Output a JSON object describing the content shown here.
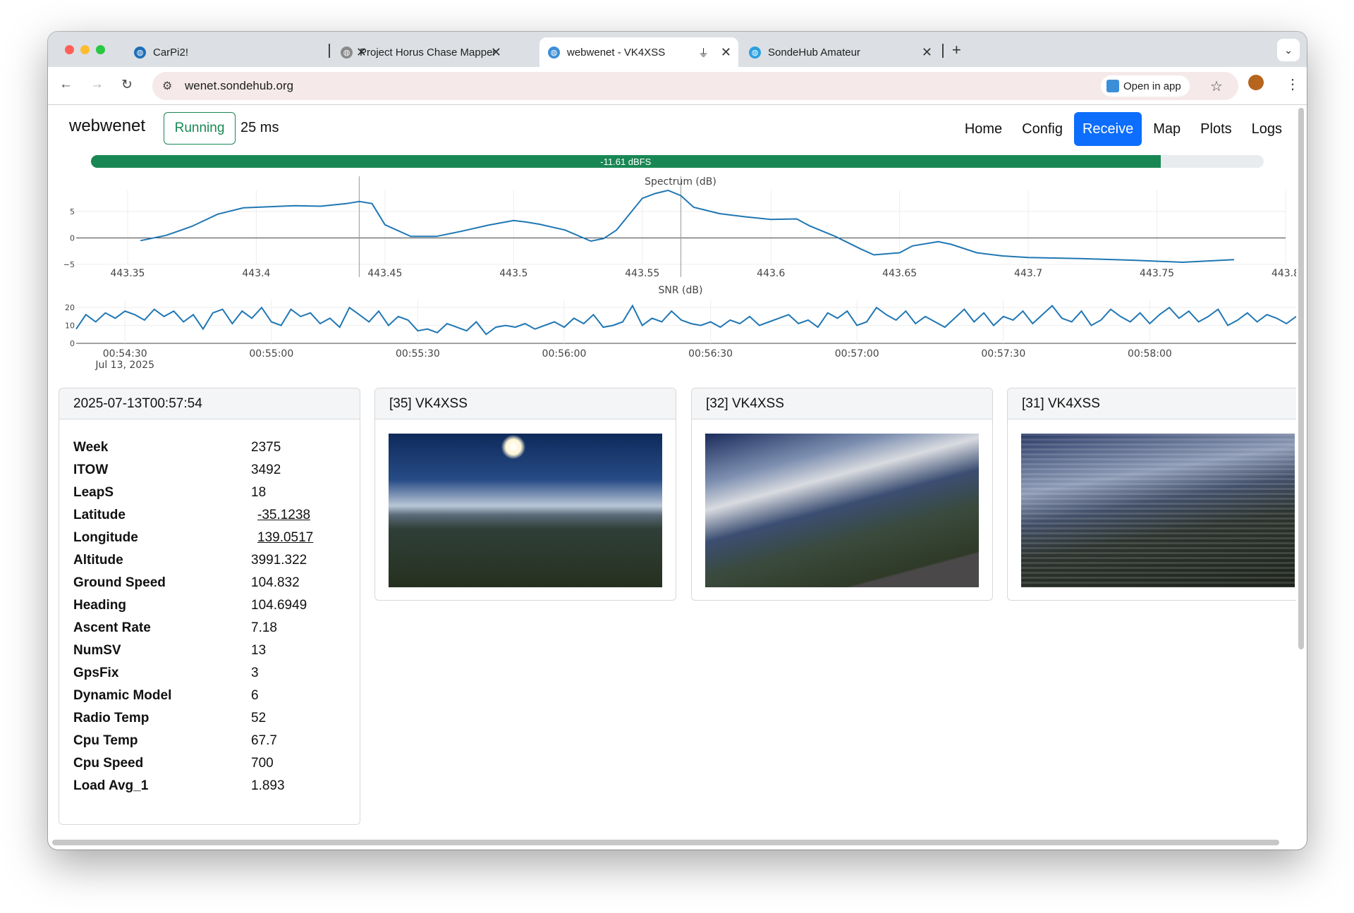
{
  "browser": {
    "tabs": [
      {
        "title": "CarPi2!",
        "icon": "globe-icon",
        "color": "#1d6fb8"
      },
      {
        "title": "Project Horus Chase Mapper",
        "icon": "globe-icon",
        "color": "#8a8a8a"
      },
      {
        "title": "webwenet - VK4XSS",
        "icon": "globe-icon",
        "color": "#3b8fd9"
      },
      {
        "title": "SondeHub Amateur",
        "icon": "globe-icon",
        "color": "#2aa1e0"
      }
    ],
    "active_tab": 2,
    "url": "wenet.sondehub.org",
    "open_in_app_label": "Open in app"
  },
  "app": {
    "brand": "webwenet",
    "status": "Running",
    "latency": "25 ms",
    "nav": [
      "Home",
      "Config",
      "Receive",
      "Map",
      "Plots",
      "Logs"
    ],
    "active_nav": "Receive",
    "level": {
      "label": "-11.61 dBFS",
      "fraction": 0.912
    }
  },
  "charts": {
    "accent": "#1f77b4",
    "spectrum": {
      "title": "Spectrum (dB)",
      "x_ticks": [
        "443.35",
        "443.4",
        "443.45",
        "443.5",
        "443.55",
        "443.6",
        "443.65",
        "443.7",
        "443.75",
        "443.8"
      ],
      "y_ticks": [
        "5",
        "0",
        "−5"
      ]
    },
    "snr": {
      "title": "SNR (dB)",
      "x_ticks": [
        "00:54:30",
        "00:55:00",
        "00:55:30",
        "00:56:00",
        "00:56:30",
        "00:57:00",
        "00:57:30",
        "00:58:00"
      ],
      "x_subtick": "Jul 13, 2025",
      "y_ticks": [
        "20",
        "10",
        "0"
      ]
    }
  },
  "chart_data": [
    {
      "type": "line",
      "title": "Spectrum (dB)",
      "xlabel": "",
      "ylabel": "",
      "ylim": [
        -5,
        9
      ],
      "series": [
        {
          "x": [
            443.355,
            443.365,
            443.375,
            443.385,
            443.395,
            443.405,
            443.415,
            443.425,
            443.435,
            443.44,
            443.445,
            443.45,
            443.46,
            443.47,
            443.48,
            443.49,
            443.5,
            443.505,
            443.51,
            443.52,
            443.53,
            443.535,
            443.54,
            443.55,
            443.555,
            443.56,
            443.565,
            443.57,
            443.58,
            443.59,
            443.6,
            443.61,
            443.615,
            443.625,
            443.635,
            443.64,
            443.65,
            443.655,
            443.665,
            443.67,
            443.68,
            443.69,
            443.7,
            443.72,
            443.74,
            443.76,
            443.78
          ],
          "y": [
            -0.5,
            0.5,
            2.2,
            4.5,
            5.7,
            5.9,
            6.1,
            6.0,
            6.5,
            6.9,
            6.5,
            2.5,
            0.3,
            0.3,
            1.3,
            2.4,
            3.3,
            3.0,
            2.6,
            1.5,
            -0.6,
            -0.1,
            1.5,
            7.5,
            8.4,
            9.0,
            8.0,
            5.8,
            4.6,
            4.0,
            3.5,
            3.6,
            2.3,
            0.3,
            -2.1,
            -3.2,
            -2.8,
            -1.5,
            -0.7,
            -1.2,
            -2.8,
            -3.4,
            -3.7,
            -3.9,
            -4.2,
            -4.6,
            -4.1
          ]
        }
      ]
    },
    {
      "type": "line",
      "title": "SNR (dB)",
      "xlabel": "",
      "ylabel": "",
      "ylim": [
        0,
        24
      ],
      "x_range": [
        "00:54:20",
        "00:58:30"
      ],
      "series": [
        {
          "x_seconds": [
            0,
            2,
            4,
            6,
            8,
            10,
            12,
            14,
            16,
            18,
            20,
            22,
            24,
            26,
            28,
            30,
            32,
            34,
            36,
            38,
            40,
            42,
            44,
            46,
            48,
            50,
            52,
            54,
            56,
            58,
            60,
            62,
            64,
            66,
            68,
            70,
            72,
            74,
            76,
            78,
            80,
            82,
            84,
            86,
            88,
            90,
            92,
            94,
            96,
            98,
            100,
            102,
            104,
            106,
            108,
            110,
            112,
            114,
            116,
            118,
            120,
            122,
            124,
            126,
            128,
            130,
            132,
            134,
            136,
            138,
            140,
            142,
            144,
            146,
            148,
            150,
            152,
            154,
            156,
            158,
            160,
            162,
            164,
            166,
            168,
            170,
            172,
            174,
            176,
            178,
            180,
            182,
            184,
            186,
            188,
            190,
            192,
            194,
            196,
            198,
            200,
            202,
            204,
            206,
            208,
            210,
            212,
            214,
            216,
            218,
            220,
            222,
            224,
            226,
            228,
            230,
            232,
            234,
            236,
            238,
            240,
            242,
            244,
            246,
            248,
            250
          ],
          "y": [
            8,
            16,
            12,
            17,
            14,
            18,
            16,
            13,
            19,
            15,
            18,
            12,
            16,
            8,
            17,
            19,
            11,
            18,
            14,
            20,
            12,
            10,
            19,
            15,
            17,
            11,
            14,
            9,
            20,
            16,
            12,
            18,
            10,
            15,
            13,
            7,
            8,
            6,
            11,
            9,
            7,
            12,
            5,
            9,
            10,
            9,
            11,
            8,
            10,
            12,
            9,
            14,
            11,
            16,
            9,
            10,
            12,
            21,
            10,
            14,
            12,
            18,
            13,
            11,
            10,
            12,
            9,
            13,
            11,
            15,
            10,
            12,
            14,
            16,
            11,
            13,
            9,
            17,
            14,
            18,
            10,
            12,
            20,
            16,
            13,
            18,
            11,
            15,
            12,
            9,
            14,
            19,
            12,
            17,
            10,
            15,
            13,
            18,
            11,
            16,
            21,
            14,
            12,
            18,
            10,
            13,
            19,
            15,
            12,
            17,
            11,
            16,
            20,
            14,
            18,
            12,
            15,
            19,
            10,
            13,
            17,
            12,
            16,
            14,
            11,
            15
          ]
        }
      ]
    }
  ],
  "telemetry": {
    "timestamp": "2025-07-13T00:57:54",
    "rows": [
      {
        "key": "Week",
        "value": "2375"
      },
      {
        "key": "ITOW",
        "value": "3492"
      },
      {
        "key": "LeapS",
        "value": "18"
      },
      {
        "key": "Latitude",
        "value": "-35.1238",
        "link": true
      },
      {
        "key": "Longitude",
        "value": "139.0517",
        "link": true
      },
      {
        "key": "Altitude",
        "value": "3991.322"
      },
      {
        "key": "Ground Speed",
        "value": "104.832"
      },
      {
        "key": "Heading",
        "value": "104.6949"
      },
      {
        "key": "Ascent Rate",
        "value": "7.18"
      },
      {
        "key": "NumSV",
        "value": "13"
      },
      {
        "key": "GpsFix",
        "value": "3"
      },
      {
        "key": "Dynamic Model",
        "value": "6"
      },
      {
        "key": "Radio Temp",
        "value": "52"
      },
      {
        "key": "Cpu Temp",
        "value": "67.7"
      },
      {
        "key": "Cpu Speed",
        "value": "700"
      },
      {
        "key": "Load Avg_1",
        "value": "1.893"
      }
    ]
  },
  "images": [
    {
      "title": "[35] VK4XSS"
    },
    {
      "title": "[32] VK4XSS"
    },
    {
      "title": "[31] VK4XSS"
    }
  ]
}
